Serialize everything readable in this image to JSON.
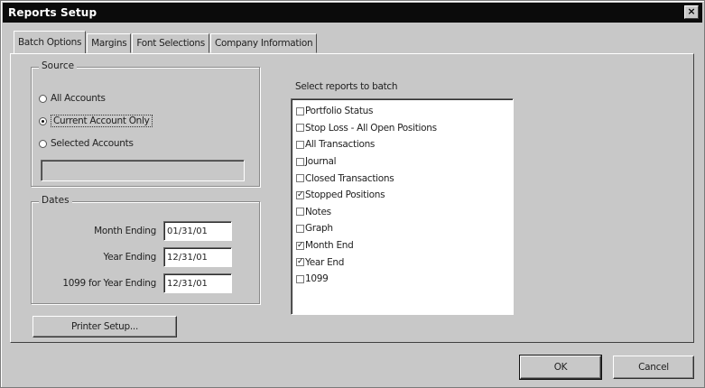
{
  "window": {
    "title": "Reports Setup",
    "close_glyph": "×"
  },
  "tabs": [
    {
      "label": "Batch Options",
      "active": true
    },
    {
      "label": "Margins",
      "active": false
    },
    {
      "label": "Font Selections",
      "active": false
    },
    {
      "label": "Company Information",
      "active": false
    }
  ],
  "source": {
    "group_label": "Source",
    "options": [
      {
        "label": "All Accounts",
        "selected": false
      },
      {
        "label": "Current Account Only",
        "selected": true
      },
      {
        "label": "Selected Accounts",
        "selected": false
      }
    ],
    "selected_accounts_value": ""
  },
  "dates": {
    "group_label": "Dates",
    "rows": [
      {
        "label": "Month Ending",
        "value": "01/31/01"
      },
      {
        "label": "Year Ending",
        "value": "12/31/01"
      },
      {
        "label": "1099 for Year Ending",
        "value": "12/31/01"
      }
    ]
  },
  "reports": {
    "label": "Select reports to batch",
    "items": [
      {
        "label": "Portfolio Status",
        "checked": false
      },
      {
        "label": "Stop Loss - All Open Positions",
        "checked": false
      },
      {
        "label": "All Transactions",
        "checked": false
      },
      {
        "label": "Journal",
        "checked": false
      },
      {
        "label": "Closed Transactions",
        "checked": false
      },
      {
        "label": "Stopped Positions",
        "checked": true
      },
      {
        "label": "Notes",
        "checked": false
      },
      {
        "label": "Graph",
        "checked": false
      },
      {
        "label": "Month End",
        "checked": true
      },
      {
        "label": "Year End",
        "checked": true
      },
      {
        "label": "1099",
        "checked": false
      }
    ]
  },
  "buttons": {
    "printer_setup": "Printer Setup...",
    "ok": "OK",
    "cancel": "Cancel"
  }
}
